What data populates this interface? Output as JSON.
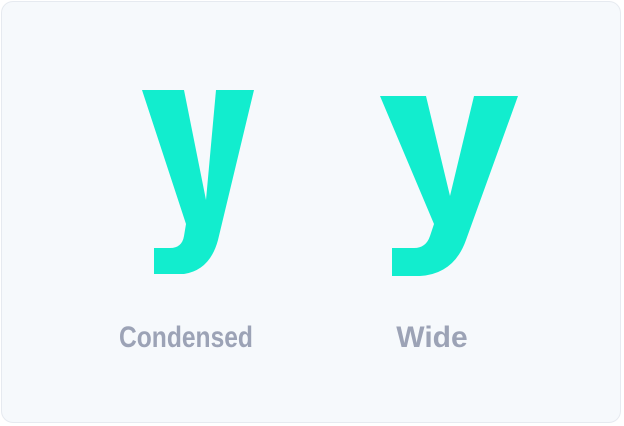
{
  "colors": {
    "glyph": "#12edce",
    "caption": "#9ca3b6",
    "background": "#f6f9fc"
  },
  "specimens": [
    {
      "glyph": "y",
      "label": "Condensed"
    },
    {
      "glyph": "y",
      "label": "Wide"
    }
  ]
}
